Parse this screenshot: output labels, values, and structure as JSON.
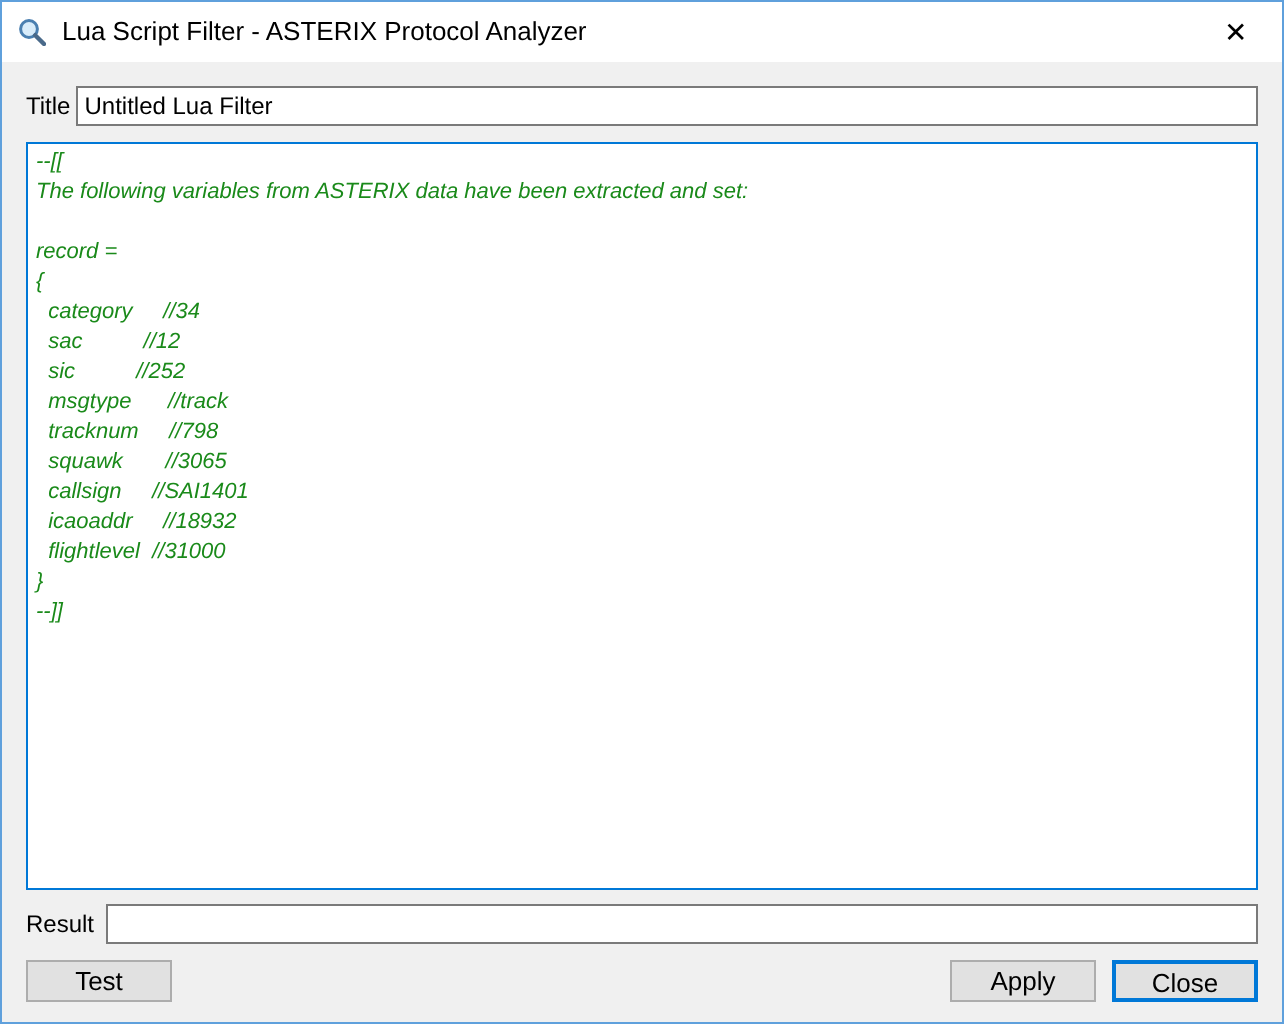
{
  "window": {
    "title": "Lua Script Filter - ASTERIX Protocol Analyzer",
    "close": "✕"
  },
  "title_field": {
    "label": "Title",
    "value": "Untitled Lua Filter"
  },
  "script": [
    [
      "--[[",
      "The following variables from ASTERIX data have been extracted and set:"
    ],
    [
      "record =",
      "{",
      "  category     //34",
      "  sac          //12",
      "  sic          //252",
      "  msgtype      //track",
      "  tracknum     //798",
      "  squawk       //3065",
      "  callsign     //SAI1401",
      "  icaoaddr     //18932",
      "  flightlevel  //31000",
      "}",
      "--]]"
    ]
  ],
  "result_field": {
    "label": "Result"
  },
  "left_buttons": [
    {
      "label": "Test",
      "default": false
    }
  ],
  "right_buttons": [
    {
      "label": "Apply",
      "default": false
    },
    {
      "label": "Close",
      "default": true
    }
  ]
}
